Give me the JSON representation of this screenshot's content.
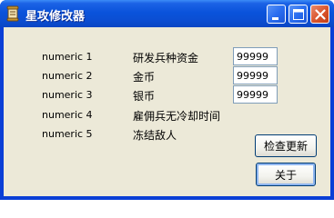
{
  "window": {
    "title": "星攻修改器",
    "icons": {
      "app": "scroll-app-icon",
      "minimize": "minimize-icon",
      "maximize": "maximize-icon",
      "close": "close-icon"
    }
  },
  "rows": [
    {
      "label": "numeric 1",
      "desc": "研发兵种资金",
      "value": "99999"
    },
    {
      "label": "numeric 2",
      "desc": "金币",
      "value": "99999"
    },
    {
      "label": "numeric 3",
      "desc": "银币",
      "value": "99999"
    },
    {
      "label": "numeric 4",
      "desc": "雇佣兵无冷却时间"
    },
    {
      "label": "numeric 5",
      "desc": "冻结敌人"
    }
  ],
  "buttons": {
    "check_update": "检查更新",
    "about": "关于"
  },
  "colors": {
    "title_bar": "#0a53db",
    "client": "#ece9d8",
    "close_button": "#d9532b"
  }
}
